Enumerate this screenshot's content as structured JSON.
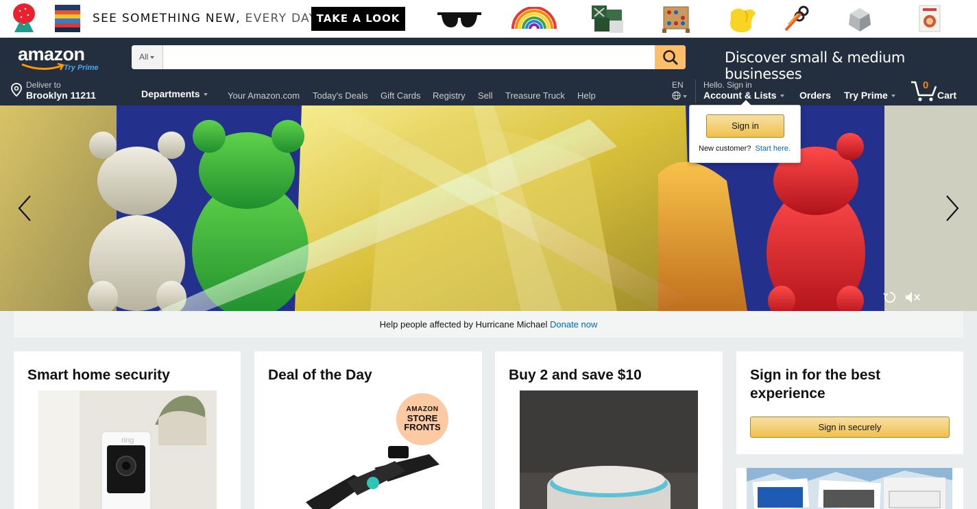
{
  "promo": {
    "headline_bold": "SEE SOMETHING NEW,",
    "headline_light": "EVERY DAY.",
    "cta": "TAKE A LOOK"
  },
  "header": {
    "logo_text": "amazon",
    "logo_sub": "Try Prime",
    "search": {
      "category": "All",
      "placeholder": ""
    },
    "discover": "Discover small & medium businesses",
    "deliver": {
      "line1": "Deliver to",
      "line2": "Brooklyn 11211"
    },
    "departments": "Departments",
    "nav": [
      "Your Amazon.com",
      "Today's Deals",
      "Gift Cards",
      "Registry",
      "Sell",
      "Treasure Truck",
      "Help"
    ],
    "lang": "EN",
    "account": {
      "line1": "Hello. Sign in",
      "line2": "Account & Lists"
    },
    "orders": "Orders",
    "try_prime": "Try Prime",
    "cart": {
      "count": "0",
      "label": "Cart"
    }
  },
  "flyout": {
    "button": "Sign in",
    "new_customer": "New customer?",
    "start_here": "Start here."
  },
  "donate": {
    "text": "Help people affected by Hurricane Michael",
    "link": "Donate now"
  },
  "cards": {
    "security": "Smart home security",
    "deal": "Deal of the Day",
    "storefront": {
      "line1": "AMAZON",
      "line2": "STORE",
      "line3": "FRONTS"
    },
    "buy2": "Buy 2 and save $10",
    "signin_title": "Sign in for the best experience",
    "signin_button": "Sign in securely",
    "ring_brand": "ring"
  },
  "colors": {
    "nav_bg": "#232f3e",
    "search_button": "#febd69",
    "link": "#0066c0",
    "cart_count": "#f08804"
  }
}
